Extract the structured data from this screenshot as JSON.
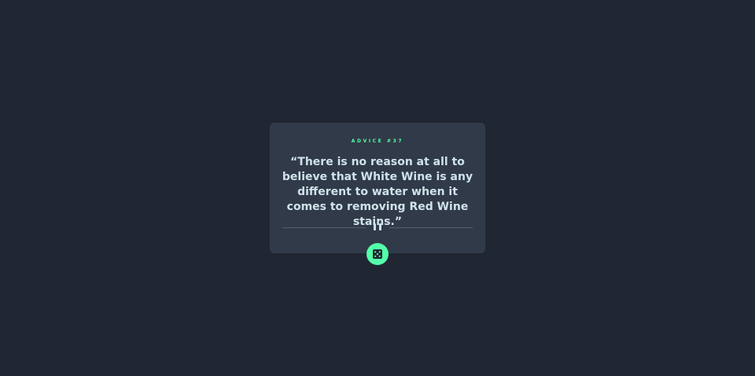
{
  "advice": {
    "label": "ADVICE #37",
    "quote": "“There is no reason at all to believe that White Wine is any different to water when it comes to removing Red Wine stains.”"
  },
  "icons": {
    "divider": "pause-icon",
    "button": "dice-icon"
  },
  "colors": {
    "background": "#202632",
    "card": "#313a48",
    "accent": "#53ffaa",
    "text": "#cee3e9",
    "divider": "#4f5d74"
  }
}
